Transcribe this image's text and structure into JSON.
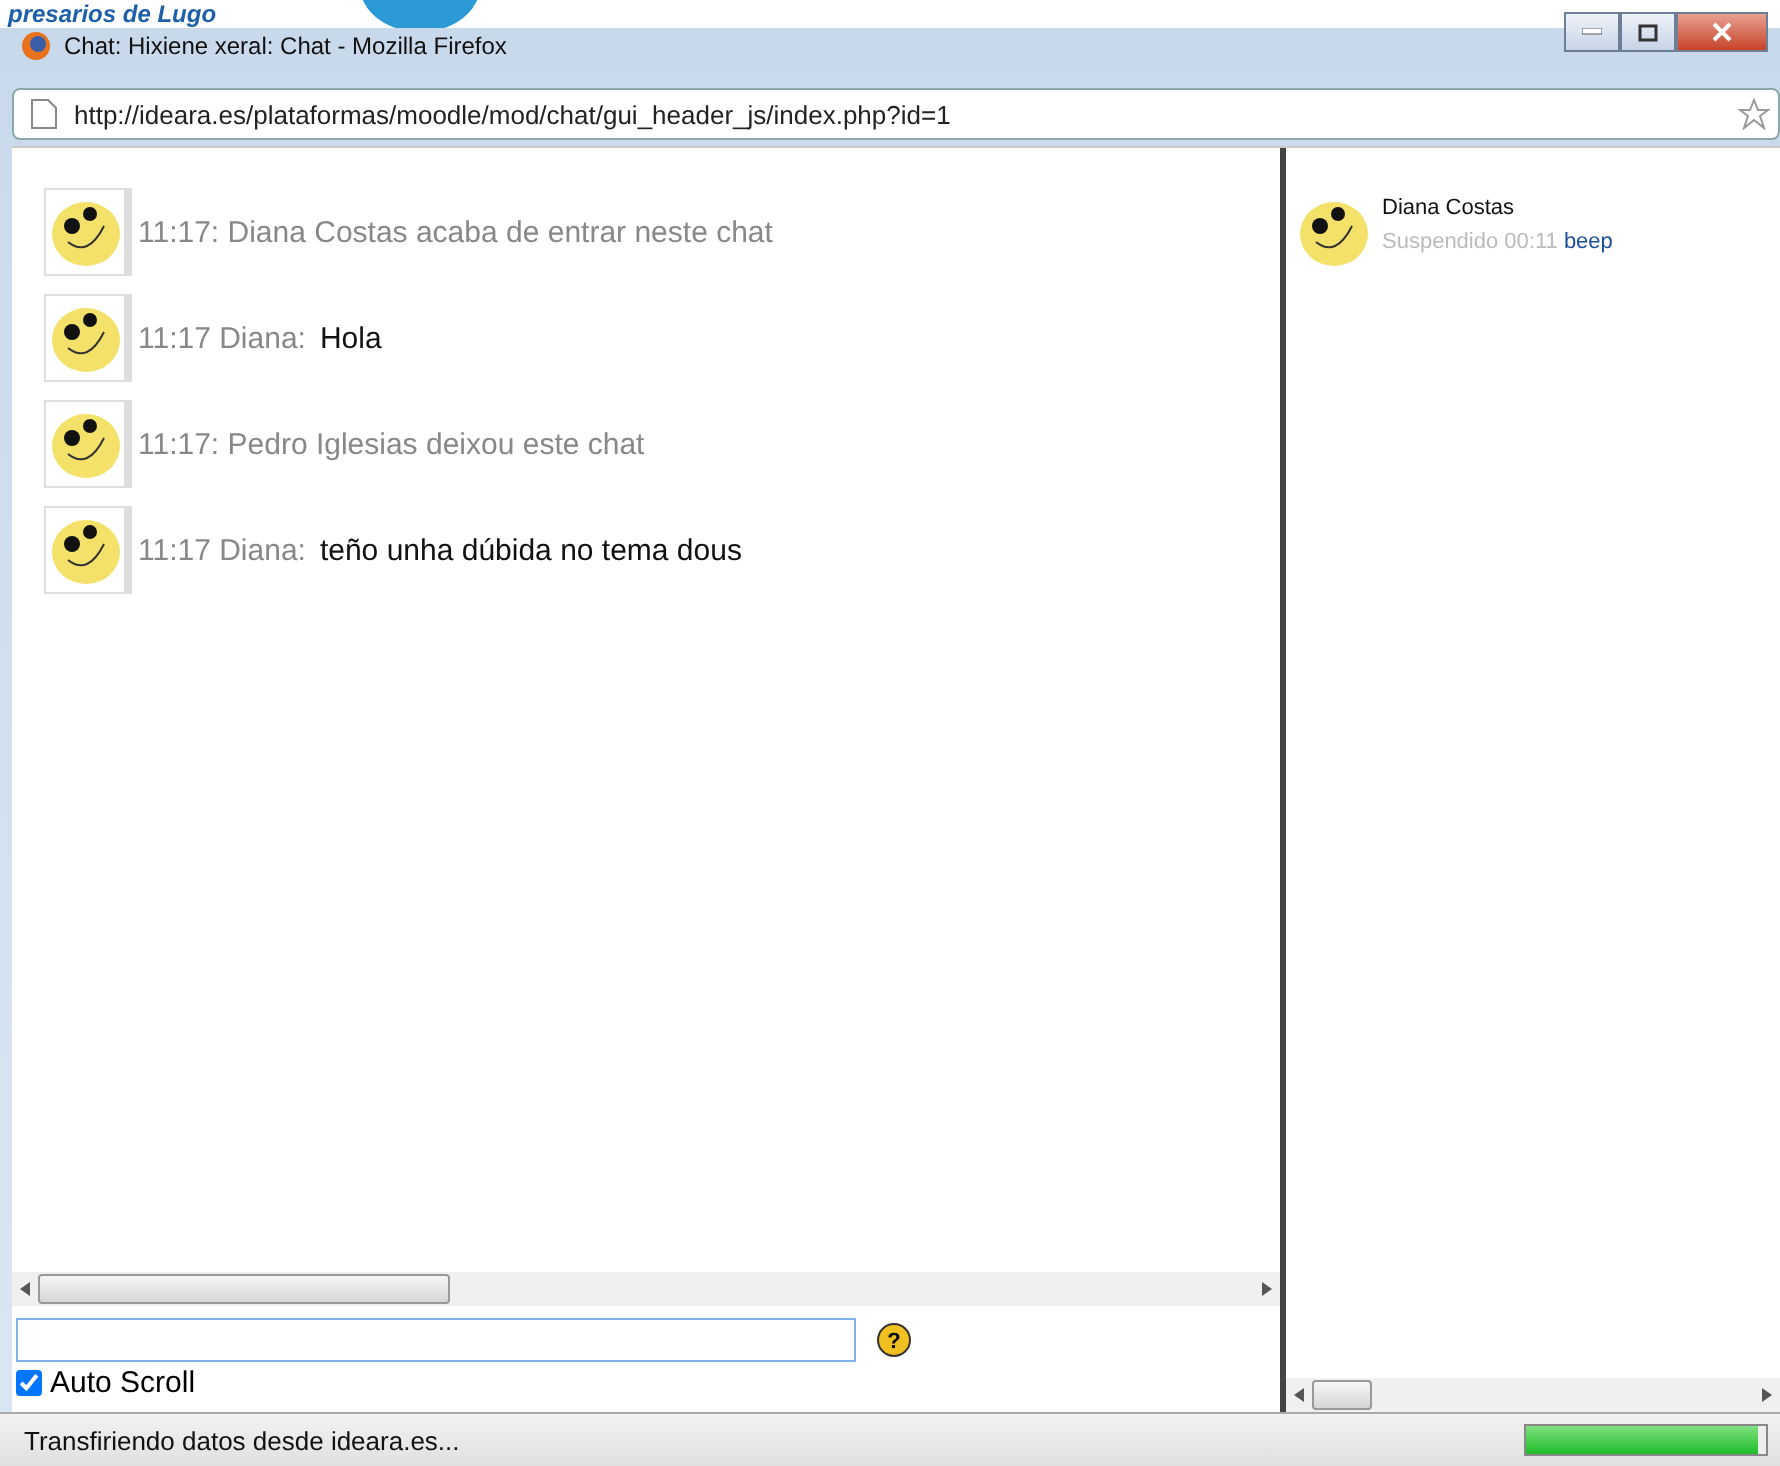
{
  "backdrop": {
    "text": "presarios de Lugo"
  },
  "window": {
    "title": "Chat: Hixiene xeral: Chat - Mozilla Firefox"
  },
  "address_bar": {
    "url": "http://ideara.es/plataformas/moodle/mod/chat/gui_header_js/index.php?id=1"
  },
  "messages": [
    {
      "kind": "system",
      "text": "11:17: Diana Costas acaba de entrar neste chat"
    },
    {
      "kind": "message",
      "sender": "11:17 Diana:",
      "text": "Hola"
    },
    {
      "kind": "system",
      "text": "11:17: Pedro Iglesias deixou este chat"
    },
    {
      "kind": "message",
      "sender": "11:17 Diana:",
      "text": "teño unha dúbida no tema dous"
    }
  ],
  "input": {
    "help": "?",
    "auto_scroll": {
      "label": "Auto Scroll",
      "checked": true
    }
  },
  "users": [
    {
      "name": "Diana Costas",
      "status": "Suspendido 00:11",
      "action": "beep"
    }
  ],
  "status_bar": {
    "text": "Transfiriendo datos desde ideara.es...",
    "progress": {
      "level": 0.97
    }
  }
}
